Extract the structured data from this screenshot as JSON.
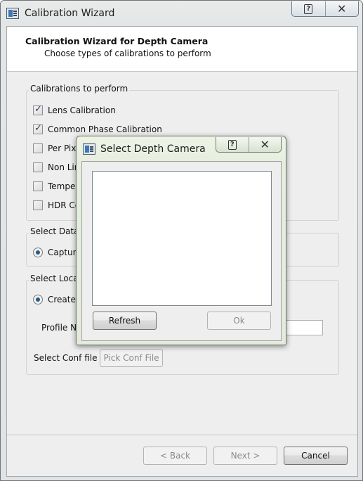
{
  "window": {
    "title": "Calibration Wizard",
    "help_glyph": "?",
    "close_glyph": "✕"
  },
  "header": {
    "title": "Calibration Wizard for Depth Camera",
    "subtitle": "Choose types of calibrations to perform"
  },
  "calibrations": {
    "group_label": "Calibrations to perform",
    "items": [
      {
        "label": "Lens Calibration",
        "checked": true
      },
      {
        "label": "Common Phase Calibration",
        "checked": true
      },
      {
        "label": "Per Pix",
        "checked": false
      },
      {
        "label": "Non Lin",
        "checked": false
      },
      {
        "label": "Temper",
        "checked": false
      },
      {
        "label": "HDR Co",
        "checked": false
      }
    ]
  },
  "data_source": {
    "group_label": "Select Data",
    "option_label": "Captur"
  },
  "location": {
    "group_label": "Select Loca",
    "option_label": "Create",
    "profile_label": "Profile Na",
    "profile_value": "",
    "conf_label": "Select Conf file",
    "pick_conf_label": "Pick Conf File"
  },
  "footer": {
    "back_label": "< Back",
    "next_label": "Next >",
    "cancel_label": "Cancel"
  },
  "dialog": {
    "title": "Select Depth Camera",
    "help_glyph": "?",
    "close_glyph": "✕",
    "refresh_label": "Refresh",
    "ok_label": "Ok"
  },
  "icons": {
    "window_icon": "app-window-icon",
    "checkmark": "checkmark-icon"
  },
  "colors": {
    "titlebar": "#e9eaea",
    "dialog_titlebar": "#eef3e6",
    "radio_dot": "#2b5a84"
  }
}
